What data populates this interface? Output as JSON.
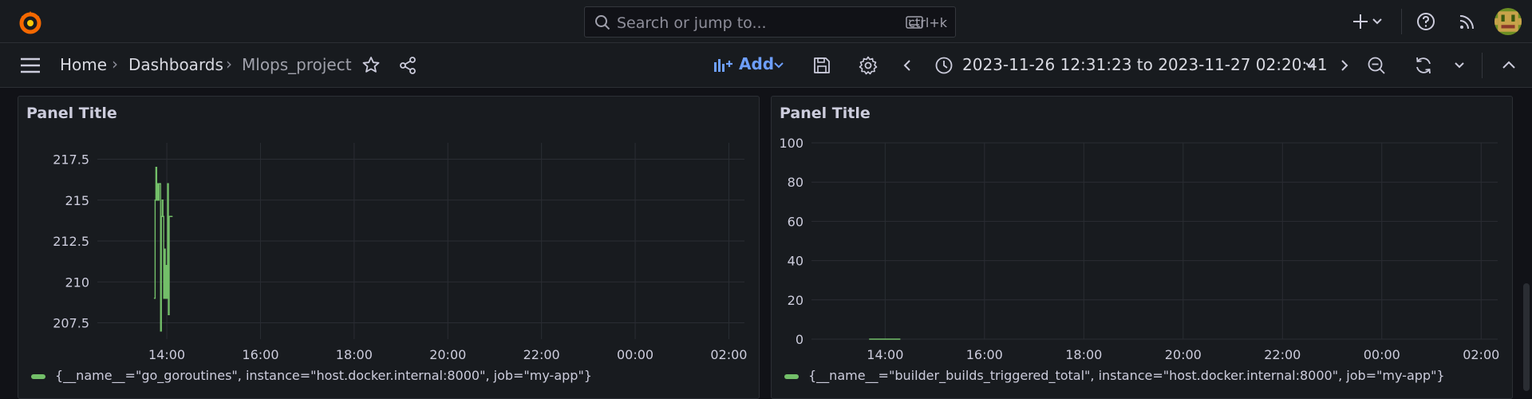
{
  "topbar": {
    "search_placeholder": "Search or jump to...",
    "search_shortcut": "ctrl+k",
    "icons": [
      "grafana-logo-icon",
      "plus-icon",
      "chevron-down-icon",
      "help-icon",
      "news-feed-icon",
      "user-avatar"
    ]
  },
  "breadcrumb": {
    "home": "Home",
    "dashboards": "Dashboards",
    "current": "Mlops_project",
    "separator": "›"
  },
  "toolbar": {
    "add_label": "Add",
    "time_range": "2023-11-26 12:31:23 to 2023-11-27 02:20:41"
  },
  "colors": {
    "accent": "#6e9fff",
    "series": "#73bf69",
    "logo": "#f46800"
  },
  "panels": [
    {
      "title": "Panel Title",
      "legend": "{__name__=\"go_goroutines\", instance=\"host.docker.internal:8000\", job=\"my-app\"}"
    },
    {
      "title": "Panel Title",
      "legend": "{__name__=\"builder_builds_triggered_total\", instance=\"host.docker.internal:8000\", job=\"my-app\"}"
    }
  ],
  "chart_data": [
    {
      "type": "line",
      "title": "Panel Title",
      "x_ticks": [
        "14:00",
        "16:00",
        "18:00",
        "20:00",
        "22:00",
        "00:00",
        "02:00"
      ],
      "y_ticks": [
        217.5,
        215,
        212.5,
        210,
        207.5
      ],
      "ylim": [
        206.5,
        218.5
      ],
      "xlim": [
        "12:31",
        "02:20"
      ],
      "grid": true,
      "legend_position": "bottom-left",
      "series": [
        {
          "name": "{__name__=\"go_goroutines\", instance=\"host.docker.internal:8000\", job=\"my-app\"}",
          "x": [
            "13:44",
            "13:45",
            "13:46",
            "13:47",
            "13:48",
            "13:49",
            "13:50",
            "13:51",
            "13:52",
            "13:53",
            "13:54",
            "13:55",
            "13:56",
            "13:57",
            "13:58",
            "13:59",
            "14:00",
            "14:01",
            "14:02",
            "14:03",
            "14:04",
            "14:05",
            "14:06",
            "14:07"
          ],
          "values": [
            209,
            215,
            217,
            215,
            216,
            215,
            216,
            216,
            207,
            214,
            215,
            214,
            209,
            212,
            209,
            211,
            209,
            216,
            208,
            214,
            214,
            214,
            214,
            214
          ]
        }
      ]
    },
    {
      "type": "line",
      "title": "Panel Title",
      "x_ticks": [
        "14:00",
        "16:00",
        "18:00",
        "20:00",
        "22:00",
        "00:00",
        "02:00"
      ],
      "y_ticks": [
        100,
        80,
        60,
        40,
        20,
        0
      ],
      "ylim": [
        0,
        100
      ],
      "xlim": [
        "12:31",
        "02:20"
      ],
      "grid": true,
      "legend_position": "bottom-left",
      "series": [
        {
          "name": "{__name__=\"builder_builds_triggered_total\", instance=\"host.docker.internal:8000\", job=\"my-app\"}",
          "x": [
            "13:41",
            "14:18"
          ],
          "values": [
            0,
            0
          ]
        }
      ]
    }
  ]
}
